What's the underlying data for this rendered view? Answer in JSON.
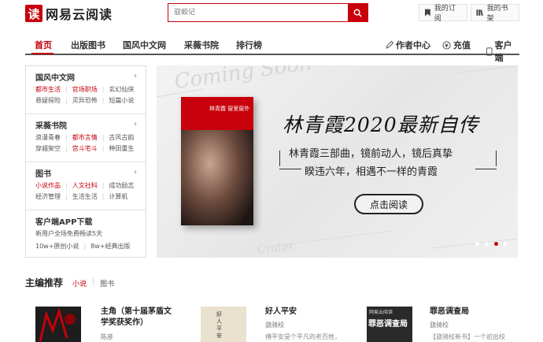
{
  "header": {
    "logo_mark": "读",
    "logo_text": "网易云阅读",
    "search_placeholder": "驭蛟记",
    "my_subscriptions": "我的订阅",
    "my_bookshelf": "我的书架"
  },
  "nav": {
    "items": [
      "首页",
      "出版图书",
      "国风中文网",
      "采薇书院",
      "排行榜"
    ],
    "right": [
      "作者中心",
      "充值",
      "客户端"
    ]
  },
  "sidebar": {
    "sections": [
      {
        "title": "国风中文网",
        "rows": [
          [
            "都市生活",
            "官场职场",
            "玄幻仙侠"
          ],
          [
            "悬疑探险",
            "灵异恐怖",
            "短篇小说"
          ]
        ]
      },
      {
        "title": "采薇书院",
        "rows": [
          [
            "浪漫青春",
            "都市言情",
            "古风古韵"
          ],
          [
            "穿越架空",
            "宫斗宅斗",
            "种田重生"
          ]
        ]
      },
      {
        "title": "图书",
        "rows": [
          [
            "小说作品",
            "人文社科",
            "成功励志"
          ],
          [
            "经济管理",
            "生活生活",
            "计算机"
          ]
        ]
      }
    ],
    "app": {
      "title": "客户端APP下载",
      "promo": "新用户全场免费畅读5天",
      "stats": [
        "10w+原创小说",
        "8w+经典出版"
      ]
    }
  },
  "banner": {
    "book_title": "林青霞 窗里窗外",
    "title": "林青霞2020最新自传",
    "sub1": "林青霞三部曲，镜前动人，镜后真挚",
    "sub2": "睽违六年，相遇不一样的青霞",
    "button": "点击阅读",
    "bg_words": [
      "Coming Soon",
      "Crater"
    ]
  },
  "recommend": {
    "title": "主编推荐",
    "tabs": [
      "小说",
      "图书"
    ],
    "cards": [
      {
        "title": "主角（第十届茅盾文学奖获奖作）",
        "title_line1": "主角（第十届茅盾文",
        "title_line2": "学奖获奖作）",
        "author": "陈彦",
        "desc": ""
      },
      {
        "title": "好人平安",
        "cover_text": "好人平安",
        "author": "骁骑校",
        "desc": "傅平安是个平凡的老百姓，"
      },
      {
        "title": "罪恶调查局",
        "cover_text": "罪恶调查局",
        "cover_badge": "网易云阅读",
        "author": "骁骑校",
        "desc": "【骁骑校新书】一个初出校"
      }
    ]
  },
  "colors": {
    "accent": "#c7000b"
  }
}
